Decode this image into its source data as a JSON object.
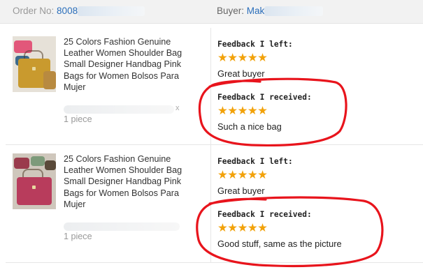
{
  "order": {
    "order_no_label": "Order No:",
    "order_no_value": "8008",
    "buyer_label": "Buyer:",
    "buyer_value": "Mak"
  },
  "items": [
    {
      "title": "25 Colors Fashion Genuine Leather Women Shoulder Bag Small Designer Handbag Pink Bags for Women Bolsos Para Mujer",
      "sku_suffix": "x",
      "quantity": "1 piece",
      "feedback_left_label": "Feedback I left:",
      "feedback_left_stars": "★★★★★",
      "feedback_left_text": "Great buyer",
      "feedback_received_label": "Feedback I received:",
      "feedback_received_stars": "★★★★★",
      "feedback_received_text": "Such a nice bag"
    },
    {
      "title": "25 Colors Fashion Genuine Leather Women Shoulder Bag Small Designer Handbag Pink Bags for Women Bolsos Para Mujer",
      "quantity": "1 piece",
      "feedback_left_label": "Feedback I left:",
      "feedback_left_stars": "★★★★★",
      "feedback_left_text": "Great buyer",
      "feedback_received_label": "Feedback I received:",
      "feedback_received_stars": "★★★★★",
      "feedback_received_text": "Good stuff, same as the picture"
    }
  ],
  "colors": {
    "star": "#f2a20a",
    "link": "#2a6ebb",
    "annotation": "#e8141c"
  }
}
